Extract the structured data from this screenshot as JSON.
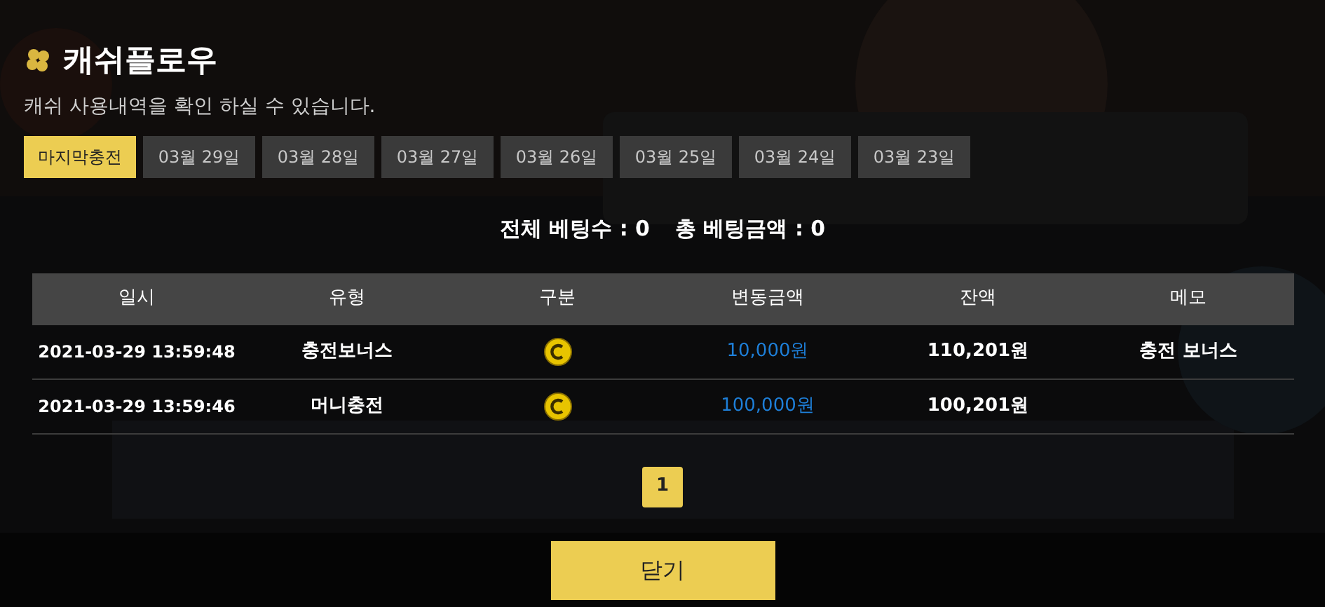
{
  "title": "캐쉬플로우",
  "subtitle": "캐쉬 사용내역을 확인 하실 수 있습니다.",
  "tabs": [
    {
      "label": "마지막충전",
      "selected": true
    },
    {
      "label": "03월 29일",
      "selected": false
    },
    {
      "label": "03월 28일",
      "selected": false
    },
    {
      "label": "03월 27일",
      "selected": false
    },
    {
      "label": "03월 26일",
      "selected": false
    },
    {
      "label": "03월 25일",
      "selected": false
    },
    {
      "label": "03월 24일",
      "selected": false
    },
    {
      "label": "03월 23일",
      "selected": false
    }
  ],
  "summary": {
    "bet_count_label": "전체 베팅수 : 0",
    "bet_amount_label": "총 베팅금액 : 0"
  },
  "table": {
    "columns": [
      "일시",
      "유형",
      "구분",
      "변동금액",
      "잔액",
      "메모"
    ],
    "rows": [
      {
        "datetime": "2021-03-29 13:59:48",
        "type": "충전보너스",
        "amount": "10,000원",
        "balance": "110,201원",
        "memo": "충전 보너스"
      },
      {
        "datetime": "2021-03-29 13:59:46",
        "type": "머니충전",
        "amount": "100,000원",
        "balance": "100,201원"
      }
    ]
  },
  "pagination": [
    {
      "label": "1",
      "selected": true
    }
  ],
  "close_button": "닫기"
}
